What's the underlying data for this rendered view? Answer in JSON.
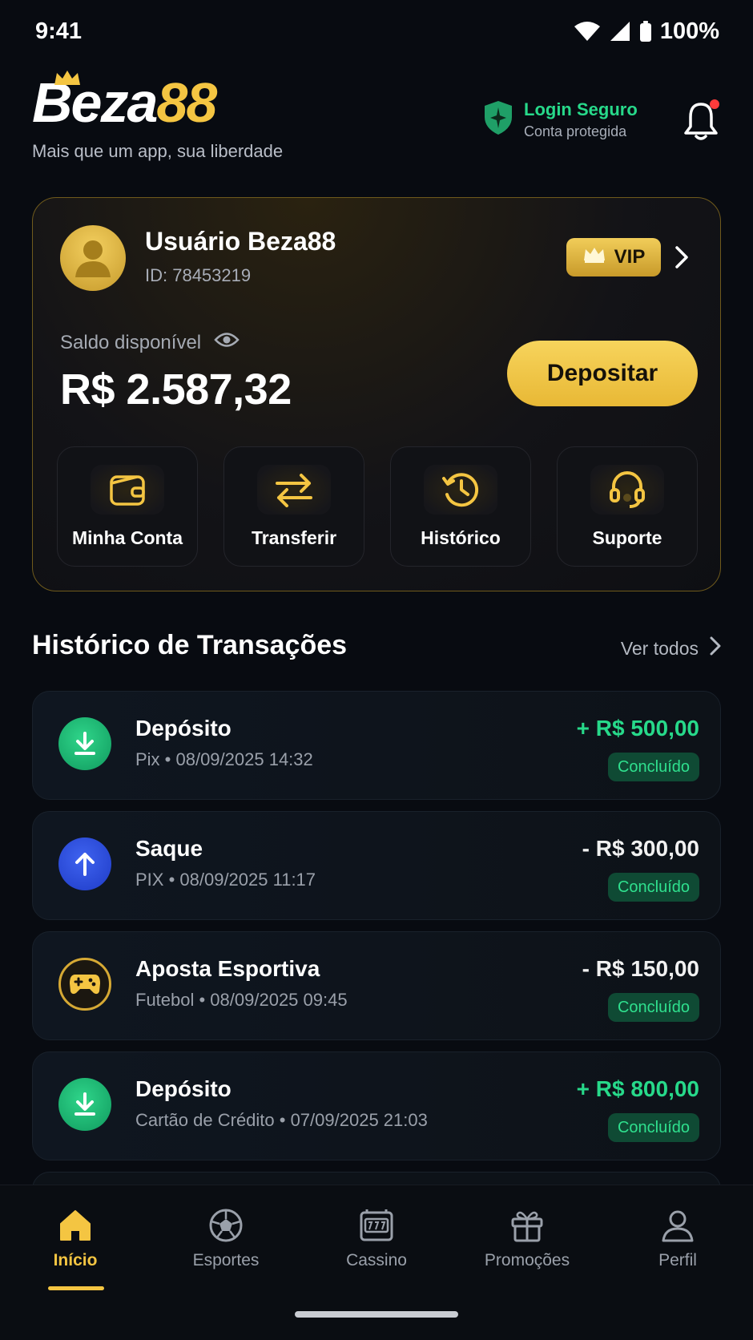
{
  "status_bar": {
    "time": "9:41",
    "battery": "100%"
  },
  "header": {
    "logo_part1": "Beza",
    "logo_part2": "88",
    "tagline": "Mais que um app, sua liberdade",
    "secure_title": "Login Seguro",
    "secure_subtitle": "Conta protegida"
  },
  "account": {
    "user_name": "Usuário Beza88",
    "user_id": "ID: 78453219",
    "vip_label": "VIP",
    "balance_label": "Saldo disponível",
    "balance_value": "R$ 2.587,32",
    "deposit_label": "Depositar",
    "actions": [
      {
        "label": "Minha Conta",
        "icon": "wallet-icon"
      },
      {
        "label": "Transferir",
        "icon": "transfer-icon"
      },
      {
        "label": "Histórico",
        "icon": "history-icon"
      },
      {
        "label": "Suporte",
        "icon": "headset-icon"
      }
    ]
  },
  "transactions": {
    "title": "Histórico de Transações",
    "see_all": "Ver todos",
    "items": [
      {
        "title": "Depósito",
        "subtitle": "Pix • 08/09/2025 14:32",
        "amount": "+ R$ 500,00",
        "status": "Concluído",
        "type": "deposit"
      },
      {
        "title": "Saque",
        "subtitle": "PIX • 08/09/2025 11:17",
        "amount": "- R$ 300,00",
        "status": "Concluído",
        "type": "withdraw"
      },
      {
        "title": "Aposta Esportiva",
        "subtitle": "Futebol • 08/09/2025 09:45",
        "amount": "- R$ 150,00",
        "status": "Concluído",
        "type": "bet"
      },
      {
        "title": "Depósito",
        "subtitle": "Cartão de Crédito • 07/09/2025 21:03",
        "amount": "+ R$ 800,00",
        "status": "Concluído",
        "type": "deposit"
      }
    ]
  },
  "bottom_nav": {
    "items": [
      {
        "label": "Início",
        "icon": "home-icon",
        "active": true
      },
      {
        "label": "Esportes",
        "icon": "soccer-ball-icon"
      },
      {
        "label": "Cassino",
        "icon": "slot-machine-icon"
      },
      {
        "label": "Promoções",
        "icon": "gift-icon"
      },
      {
        "label": "Perfil",
        "icon": "user-icon"
      }
    ]
  },
  "colors": {
    "accent_gold": "#f4c542",
    "positive_green": "#27d98a",
    "background": "#080b11"
  }
}
